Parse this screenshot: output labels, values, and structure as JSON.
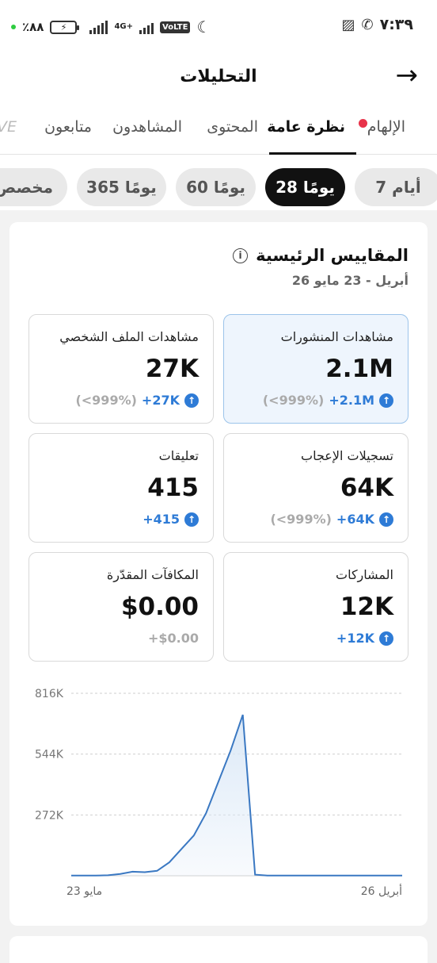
{
  "status_bar": {
    "battery_percent": "٪۸۸",
    "network": "4G+",
    "volte": "VoLTE",
    "time": "۷:۳۹"
  },
  "header": {
    "title": "التحليلات",
    "back_icon": "arrow-right-icon"
  },
  "tabs": [
    {
      "label": "الإلهام",
      "active": false,
      "badge": true
    },
    {
      "label": "نظرة عامة",
      "active": true
    },
    {
      "label": "المحتوى",
      "active": false
    },
    {
      "label": "المشاهدون",
      "active": false
    },
    {
      "label": "متابعون",
      "active": false
    },
    {
      "label": "VE",
      "active": false
    }
  ],
  "ranges": [
    {
      "label": "7 أيام",
      "active": false
    },
    {
      "label": "28 يومًا",
      "active": true
    },
    {
      "label": "60 يومًا",
      "active": false
    },
    {
      "label": "365 يومًا",
      "active": false
    },
    {
      "label": "مخصص",
      "active": false
    }
  ],
  "overview": {
    "title": "المقاييس الرئيسية",
    "date_range": "26 أبريل - 23 مايو",
    "metrics": [
      {
        "label": "مشاهدات المنشورات",
        "value": "2.1M",
        "delta": "+2.1M",
        "pct": "(<999%)",
        "highlighted": true
      },
      {
        "label": "مشاهدات الملف الشخصي",
        "value": "27K",
        "delta": "+27K",
        "pct": "(<999%)"
      },
      {
        "label": "تسجيلات الإعجاب",
        "value": "64K",
        "delta": "+64K",
        "pct": "(<999%)"
      },
      {
        "label": "تعليقات",
        "value": "415",
        "delta": "+415",
        "pct": ""
      },
      {
        "label": "المشاركات",
        "value": "12K",
        "delta": "+12K",
        "pct": ""
      },
      {
        "label": "المكافآت المقدّرة",
        "value": "$0.00",
        "delta": "+$0.00",
        "pct": ""
      }
    ]
  },
  "chart_data": {
    "type": "area",
    "title": "",
    "xlabel": "",
    "ylabel": "",
    "y_ticks": [
      "816K",
      "544K",
      "272K"
    ],
    "ylim": [
      0,
      816000
    ],
    "x_start_label": "26 أبريل",
    "x_end_label": "23 مايو",
    "series": [
      {
        "values": [
          1000,
          1000,
          1000,
          2000,
          8000,
          18000,
          16000,
          22000,
          60000,
          120000,
          180000,
          280000,
          420000,
          560000,
          720000,
          5000,
          1000,
          1000,
          1000,
          1000,
          1000,
          1000,
          1000,
          1000,
          1000,
          1000,
          1000,
          1000
        ]
      }
    ],
    "colors": {
      "line": "#3a78c2",
      "fill": "#dce9f7"
    },
    "grid": true
  }
}
